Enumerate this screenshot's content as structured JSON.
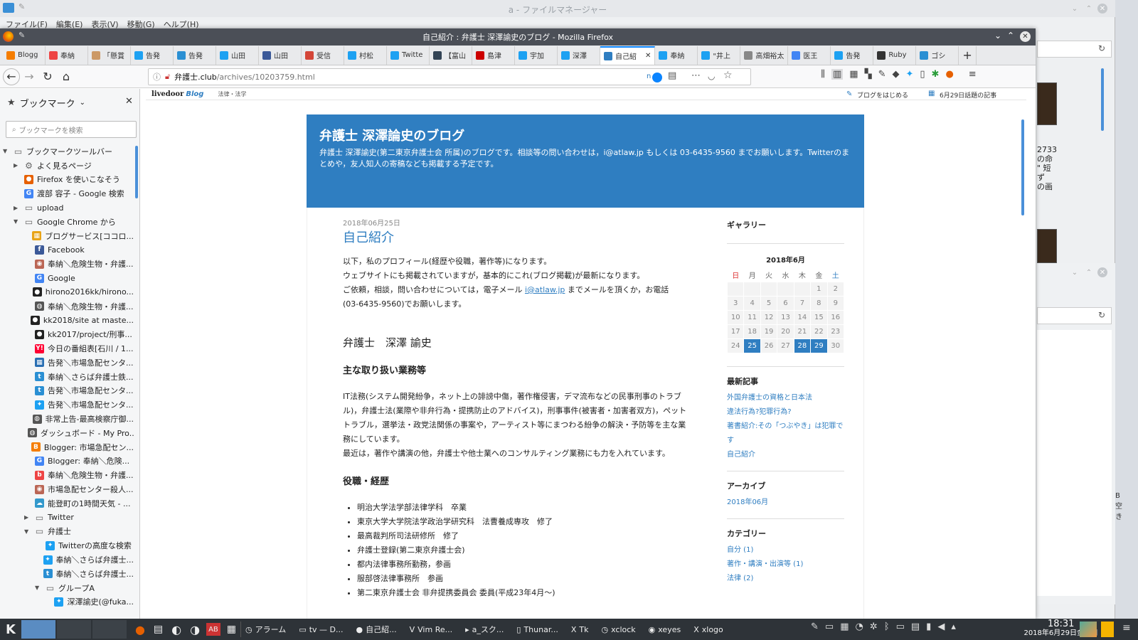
{
  "bg_window": {
    "title": "a - ファイルマネージャー",
    "menus": [
      "ファイル(F)",
      "編集(E)",
      "表示(V)",
      "移動(G)",
      "ヘルプ(H)"
    ],
    "side_text": [
      "2733",
      "の命",
      "\" 短",
      "ず",
      "の画"
    ],
    "status_text": "B 空き"
  },
  "firefox": {
    "title": "自己紹介 : 弁護士 深澤諭史のブログ - Mozilla Firefox",
    "tabs": [
      {
        "label": "Blogg",
        "icon": "blogger-icon",
        "color": "#f57d00"
      },
      {
        "label": "奉納",
        "icon": "blog-icon",
        "color": "#e44"
      },
      {
        "label": "「懸賞",
        "icon": "person-icon",
        "color": "#c96"
      },
      {
        "label": "告発",
        "icon": "twitter-icon",
        "color": "#1da1f2"
      },
      {
        "label": "告発",
        "icon": "togetter-icon",
        "color": "#2a8fd3"
      },
      {
        "label": "山田",
        "icon": "twitter-icon",
        "color": "#1da1f2"
      },
      {
        "label": "山田",
        "icon": "facebook-icon",
        "color": "#3b5998"
      },
      {
        "label": "受信",
        "icon": "gmail-icon",
        "color": "#d44638"
      },
      {
        "label": "村松",
        "icon": "twitter-icon",
        "color": "#1da1f2"
      },
      {
        "label": "Twitte",
        "icon": "twitter-icon",
        "color": "#1da1f2"
      },
      {
        "label": "【富山",
        "icon": "clock-icon",
        "color": "#345"
      },
      {
        "label": "島津",
        "icon": "news-icon",
        "color": "#c00"
      },
      {
        "label": "宇加",
        "icon": "twitter-icon",
        "color": "#1da1f2"
      },
      {
        "label": "深澤",
        "icon": "twitter-icon",
        "color": "#1da1f2"
      },
      {
        "label": "自己紹",
        "icon": "",
        "color": "#2f7ec1",
        "active": true
      },
      {
        "label": "奉納",
        "icon": "twitter-icon",
        "color": "#1da1f2"
      },
      {
        "label": "\"井上",
        "icon": "twitter-icon",
        "color": "#1da1f2"
      },
      {
        "label": "高畑裕太",
        "icon": "",
        "color": "#888"
      },
      {
        "label": "医王",
        "icon": "google-icon",
        "color": "#4285f4"
      },
      {
        "label": "告発",
        "icon": "twitter-icon",
        "color": "#1da1f2"
      },
      {
        "label": "Ruby",
        "icon": "ruby-icon",
        "color": "#333"
      },
      {
        "label": "ゴシ",
        "icon": "togetter-icon",
        "color": "#2a8fd3"
      }
    ],
    "url": "弁護士.club/archives/10203759.html",
    "url_host": "弁護士.club",
    "url_path": "/archives/10203759.html",
    "toggle_label": "n"
  },
  "sidebar": {
    "title": "ブックマーク",
    "search_placeholder": "ブックマークを検索",
    "items": [
      {
        "label": "ブックマークツールバー",
        "indent": 0,
        "type": "folder-open",
        "color": "#666"
      },
      {
        "label": "よく見るページ",
        "indent": 1,
        "type": "gear",
        "color": "#666"
      },
      {
        "label": "Firefox を使いこなそう",
        "indent": 1,
        "type": "firefox",
        "color": "#e66000"
      },
      {
        "label": "渡部 容子 - Google 検索",
        "indent": 1,
        "type": "google",
        "color": "#4285f4"
      },
      {
        "label": "upload",
        "indent": 1,
        "type": "folder",
        "color": "#666"
      },
      {
        "label": "Google Chrome から",
        "indent": 1,
        "type": "folder-open",
        "color": "#666"
      },
      {
        "label": "ブログサービス[ココロ...",
        "indent": 2,
        "type": "grid",
        "color": "#e8a317"
      },
      {
        "label": "Facebook",
        "indent": 2,
        "type": "facebook",
        "color": "#3b5998"
      },
      {
        "label": "奉納＼危険生物・弁護...",
        "indent": 2,
        "type": "person",
        "color": "#b65"
      },
      {
        "label": "Google",
        "indent": 2,
        "type": "google",
        "color": "#4285f4"
      },
      {
        "label": "hirono2016kk/hirono...",
        "indent": 2,
        "type": "github",
        "color": "#222"
      },
      {
        "label": "奉納＼危険生物・弁護...",
        "indent": 2,
        "type": "globe",
        "color": "#555"
      },
      {
        "label": "kk2018/site at maste...",
        "indent": 2,
        "type": "github",
        "color": "#222"
      },
      {
        "label": "kk2017/project/刑事...",
        "indent": 2,
        "type": "github",
        "color": "#222"
      },
      {
        "label": "今日の番組表[石川 / 1...",
        "indent": 2,
        "type": "yahoo",
        "color": "#ff0033"
      },
      {
        "label": "告発＼市場急配センタ...",
        "indent": 2,
        "type": "calendar",
        "color": "#2a6fb3"
      },
      {
        "label": "奉納＼さらば弁護士鉄...",
        "indent": 2,
        "type": "togetter",
        "color": "#2a8fd3"
      },
      {
        "label": "告発＼市場急配センタ...",
        "indent": 2,
        "type": "togetter",
        "color": "#2a8fd3"
      },
      {
        "label": "告発＼市場急配センタ...",
        "indent": 2,
        "type": "twitter",
        "color": "#1da1f2"
      },
      {
        "label": "非常上告-最高検察庁御...",
        "indent": 2,
        "type": "globe",
        "color": "#555"
      },
      {
        "label": "ダッシュボード - My Pro...",
        "indent": 2,
        "type": "globe",
        "color": "#555"
      },
      {
        "label": "Blogger: 市場急配セン...",
        "indent": 2,
        "type": "blogger",
        "color": "#f57d00"
      },
      {
        "label": "Blogger: 奉納＼危険...",
        "indent": 2,
        "type": "google",
        "color": "#4285f4"
      },
      {
        "label": "奉納＼危険生物・弁護...",
        "indent": 2,
        "type": "blog",
        "color": "#e44"
      },
      {
        "label": "市場急配センター殺人...",
        "indent": 2,
        "type": "person",
        "color": "#b65"
      },
      {
        "label": "能登町の1時間天気 - ...",
        "indent": 2,
        "type": "weather",
        "color": "#39c"
      },
      {
        "label": "Twitter",
        "indent": 2,
        "type": "folder",
        "color": "#666"
      },
      {
        "label": "弁護士",
        "indent": 2,
        "type": "folder-open",
        "color": "#666"
      },
      {
        "label": "Twitterの高度な検索",
        "indent": 3,
        "type": "twitter",
        "color": "#1da1f2"
      },
      {
        "label": "奉納＼さらば弁護士...",
        "indent": 3,
        "type": "twitter",
        "color": "#1da1f2"
      },
      {
        "label": "奉納＼さらば弁護士...",
        "indent": 3,
        "type": "togetter",
        "color": "#2a8fd3"
      },
      {
        "label": "グループA",
        "indent": 3,
        "type": "folder-open",
        "color": "#666"
      },
      {
        "label": "深澤諭史(@fuka...",
        "indent": 4,
        "type": "twitter",
        "color": "#1da1f2"
      }
    ]
  },
  "page": {
    "livedoor_logo": "livedoor",
    "livedoor_blog": "Blog",
    "category": "法律・法学",
    "start_blog": "ブログをはじめる",
    "topic_date": "6月29日話題の記事",
    "blog_title": "弁護士 深澤論史のブログ",
    "blog_desc": "弁護士 深澤諭史(第二東京弁護士会 所属)のブログです。相談等の問い合わせは，i@atlaw.jp もしくは 03-6435-9560 までお願いします。Twitterのまとめや，友人知人の寄稿なども掲載する予定です。",
    "post_date": "2018年06月25日",
    "post_title": "自己紹介",
    "intro": [
      "以下，私のプロフィール(経歴や役職，著作等)になります。",
      "ウェブサイトにも掲載されていますが，基本的にこれ(ブログ掲載)が最新になります。"
    ],
    "contact_pre": "ご依頼，相談，問い合わせについては，電子メール",
    "contact_link": "i@atlaw.jp",
    "contact_post": "までメールを頂くか，お電話",
    "contact_phone": "(03-6435-9560)でお願いします。",
    "name_heading": "弁護士　深澤 諭史",
    "work_heading": "主な取り扱い業務等",
    "work_text": "IT法務(システム開発紛争，ネット上の誹謗中傷，著作権侵害，デマ流布などの民事刑事のトラブル)，弁護士法(業際や非弁行為・提携防止のアドバイス)，刑事事件(被害者・加害者双方)，ペットトラブル，選挙法・政党法関係の事案や，アーティスト等にまつわる紛争の解決・予防等を主な業務にしています。",
    "recent_text": "最近は，著作や講演の他，弁護士や他士業へのコンサルティング業務にも力を入れています。",
    "career_heading": "役職・経歴",
    "career": [
      "明治大学法学部法律学科　卒業",
      "東京大学大学院法学政治学研究科　法曹養成専攻　修了",
      "最高裁判所司法研修所　修了",
      "弁護士登録(第二東京弁護士会)",
      "都内法律事務所勤務，参画",
      "服部啓法律事務所　参画",
      "第二東京弁護士会 非弁提携委員会 委員(平成23年4月〜)"
    ],
    "side": {
      "gallery": "ギャラリー",
      "cal_title": "2018年6月",
      "weekdays": [
        "日",
        "月",
        "火",
        "水",
        "木",
        "金",
        "土"
      ],
      "weeks": [
        [
          "",
          "",
          "",
          "",
          "",
          "1",
          "2"
        ],
        [
          "3",
          "4",
          "5",
          "6",
          "7",
          "8",
          "9"
        ],
        [
          "10",
          "11",
          "12",
          "13",
          "14",
          "15",
          "16"
        ],
        [
          "17",
          "18",
          "19",
          "20",
          "21",
          "22",
          "23"
        ],
        [
          "24",
          "25",
          "26",
          "27",
          "28",
          "29",
          "30"
        ]
      ],
      "highlighted_days": [
        "25",
        "28",
        "29"
      ],
      "recent_title": "最新記事",
      "recent": [
        "外国弁護士の資格と日本法",
        "違法行為?犯罪行為?",
        "著書紹介:その「つぶやき」は犯罪です",
        "自己紹介"
      ],
      "archive_title": "アーカイブ",
      "archive": [
        "2018年06月"
      ],
      "category_title": "カテゴリー",
      "categories": [
        "自分 (1)",
        "著作・講演・出演等 (1)",
        "法律 (2)"
      ]
    }
  },
  "taskbar": {
    "items": [
      {
        "label": "アラーム",
        "icon": "alarm-icon"
      },
      {
        "label": "tv — D...",
        "icon": "folder-icon"
      },
      {
        "label": "自己紹...",
        "icon": "firefox-icon"
      },
      {
        "label": "Vim Re...",
        "icon": "vim-icon"
      },
      {
        "label": "a_スク...",
        "icon": "terminal-icon"
      },
      {
        "label": "Thunar...",
        "icon": "thunar-icon"
      },
      {
        "label": "Tk",
        "icon": "tk-icon"
      },
      {
        "label": "xclock",
        "icon": "clock-icon"
      },
      {
        "label": "xeyes",
        "icon": "eyes-icon"
      },
      {
        "label": "xlogo",
        "icon": "xlogo-icon"
      }
    ],
    "time": "18:31",
    "date": "2018年6月29日金曜日"
  }
}
